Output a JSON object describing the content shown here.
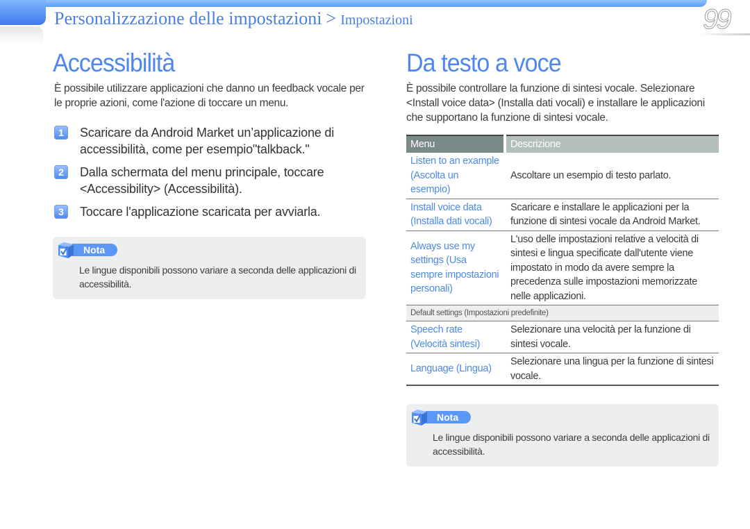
{
  "header": {
    "breadcrumb_main": "Personalizzazione delle impostazioni",
    "breadcrumb_separator": ">",
    "breadcrumb_sub": "Impostazioni",
    "page_number": "99"
  },
  "left": {
    "title": "Accessibilità",
    "intro": "È possibile utilizzare applicazioni che danno un feedback vocale per le proprie azioni, come l'azione di toccare un menu.",
    "steps": [
      {
        "num": "1",
        "text": "Scaricare da Android Market un’applicazione di accessibilità, come per esempio\"talkback.\""
      },
      {
        "num": "2",
        "text": "Dalla schermata del menu principale, toccare <Accessibility> (Accessibilità)."
      },
      {
        "num": "3",
        "text": "Toccare l'applicazione scaricata per avviarla."
      }
    ],
    "note": {
      "label": "Nota",
      "icon": "checkbox-cube-icon",
      "text": "Le lingue disponibili possono variare a seconda delle applicazioni di accessibilità."
    }
  },
  "right": {
    "title": "Da testo a voce",
    "intro": "È possibile controllare la funzione di sintesi vocale. Selezionare <Install voice data> (Installa dati vocali) e installare le applicazioni che supportano la funzione di sintesi vocale.",
    "table": {
      "headers": [
        "Menu",
        "Descrizione"
      ],
      "rows": [
        {
          "menu": "Listen to an example (Ascolta un esempio)",
          "desc": "Ascoltare un esempio di testo parlato."
        },
        {
          "menu": "Install voice data (Installa dati vocali)",
          "desc": "Scaricare e installare le applicazioni per la funzione di sintesi vocale da Android Market."
        },
        {
          "menu": "Always use my settings (Usa sempre impostazioni personali)",
          "desc": "L'uso delle impostazioni relative a velocità di sintesi e lingua specificate dall'utente viene impostato in modo da avere sempre la precedenza sulle impostazioni memorizzate nelle applicazioni."
        }
      ],
      "group_label": "Default settings (Impostazioni predefinite)",
      "group_rows": [
        {
          "menu": "Speech rate (Velocità sintesi)",
          "desc": "Selezionare una velocità per la funzione di sintesi vocale."
        },
        {
          "menu": "Language (Lingua)",
          "desc": "Selezionare una lingua per la funzione di sintesi vocale."
        }
      ]
    },
    "note": {
      "label": "Nota",
      "icon": "checkbox-cube-icon",
      "text": "Le lingue disponibili possono variare a seconda delle applicazioni di accessibilità."
    }
  },
  "colors": {
    "accent_blue": "#4f86f0",
    "link_blue": "#4c8be8",
    "note_bg": "#edeef0",
    "table_header_dark": "#7a8a88",
    "table_header_light": "#b4bfbd"
  }
}
